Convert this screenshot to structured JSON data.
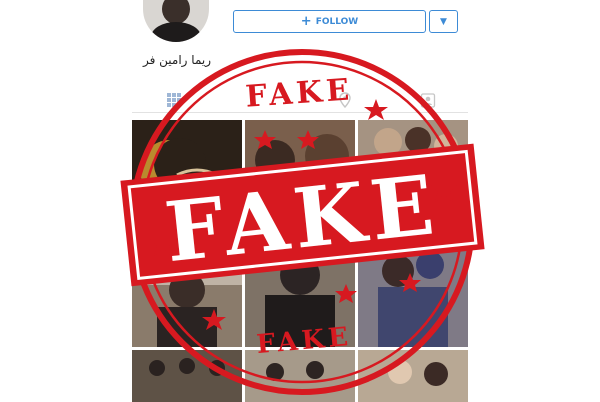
{
  "profile": {
    "name": "ریما رامین فر"
  },
  "actions": {
    "follow_label": "FOLLOW",
    "dropdown_icon": "chevron-down-icon"
  },
  "tabs": [
    {
      "icon": "grid-icon"
    },
    {
      "icon": "location-icon"
    },
    {
      "icon": "tagged-person-icon"
    }
  ],
  "stamp": {
    "top_text": "FAKE",
    "main_text": "FAKE",
    "bottom_text": "FAKE",
    "color": "#d71920"
  },
  "colors": {
    "accent": "#3d8bd6",
    "stamp": "#d71920"
  }
}
